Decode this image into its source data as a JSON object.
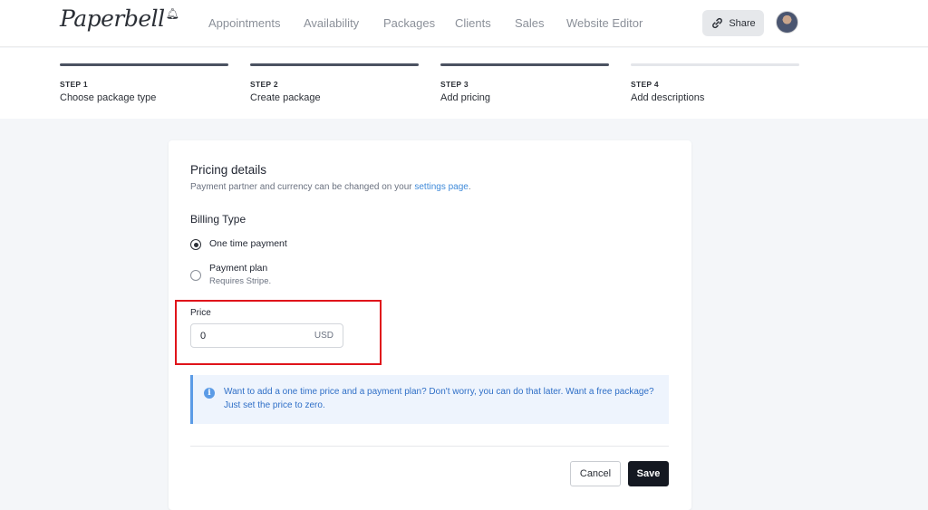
{
  "header": {
    "logo_text": "Paperbell",
    "nav": [
      "Appointments",
      "Availability",
      "Packages",
      "Clients",
      "Sales",
      "Website Editor"
    ],
    "share_label": "Share"
  },
  "steps": [
    {
      "number": "STEP 1",
      "title": "Choose package type",
      "status": "complete"
    },
    {
      "number": "STEP 2",
      "title": "Create package",
      "status": "complete"
    },
    {
      "number": "STEP 3",
      "title": "Add pricing",
      "status": "current"
    },
    {
      "number": "STEP 4",
      "title": "Add descriptions",
      "status": "pending"
    }
  ],
  "pricing": {
    "title": "Pricing details",
    "subtitle_prefix": "Payment partner and currency can be changed on your ",
    "subtitle_link": "settings page",
    "subtitle_suffix": ".",
    "billing_label": "Billing Type",
    "options": [
      {
        "label": "One time payment",
        "hint": "",
        "selected": true
      },
      {
        "label": "Payment plan",
        "hint": "Requires Stripe.",
        "selected": false
      }
    ],
    "price_label": "Price",
    "price_value": "0",
    "currency": "USD",
    "info_text": "Want to add a one time price and a payment plan? Don't worry, you can do that later. Want a free package? Just set the price to zero.",
    "cancel_label": "Cancel",
    "save_label": "Save"
  },
  "colors": {
    "accent_link": "#3f8ad9",
    "info_bg": "#eef4fd",
    "info_border": "#5b9be6",
    "highlight": "#e0141b",
    "save_bg": "#141821"
  }
}
